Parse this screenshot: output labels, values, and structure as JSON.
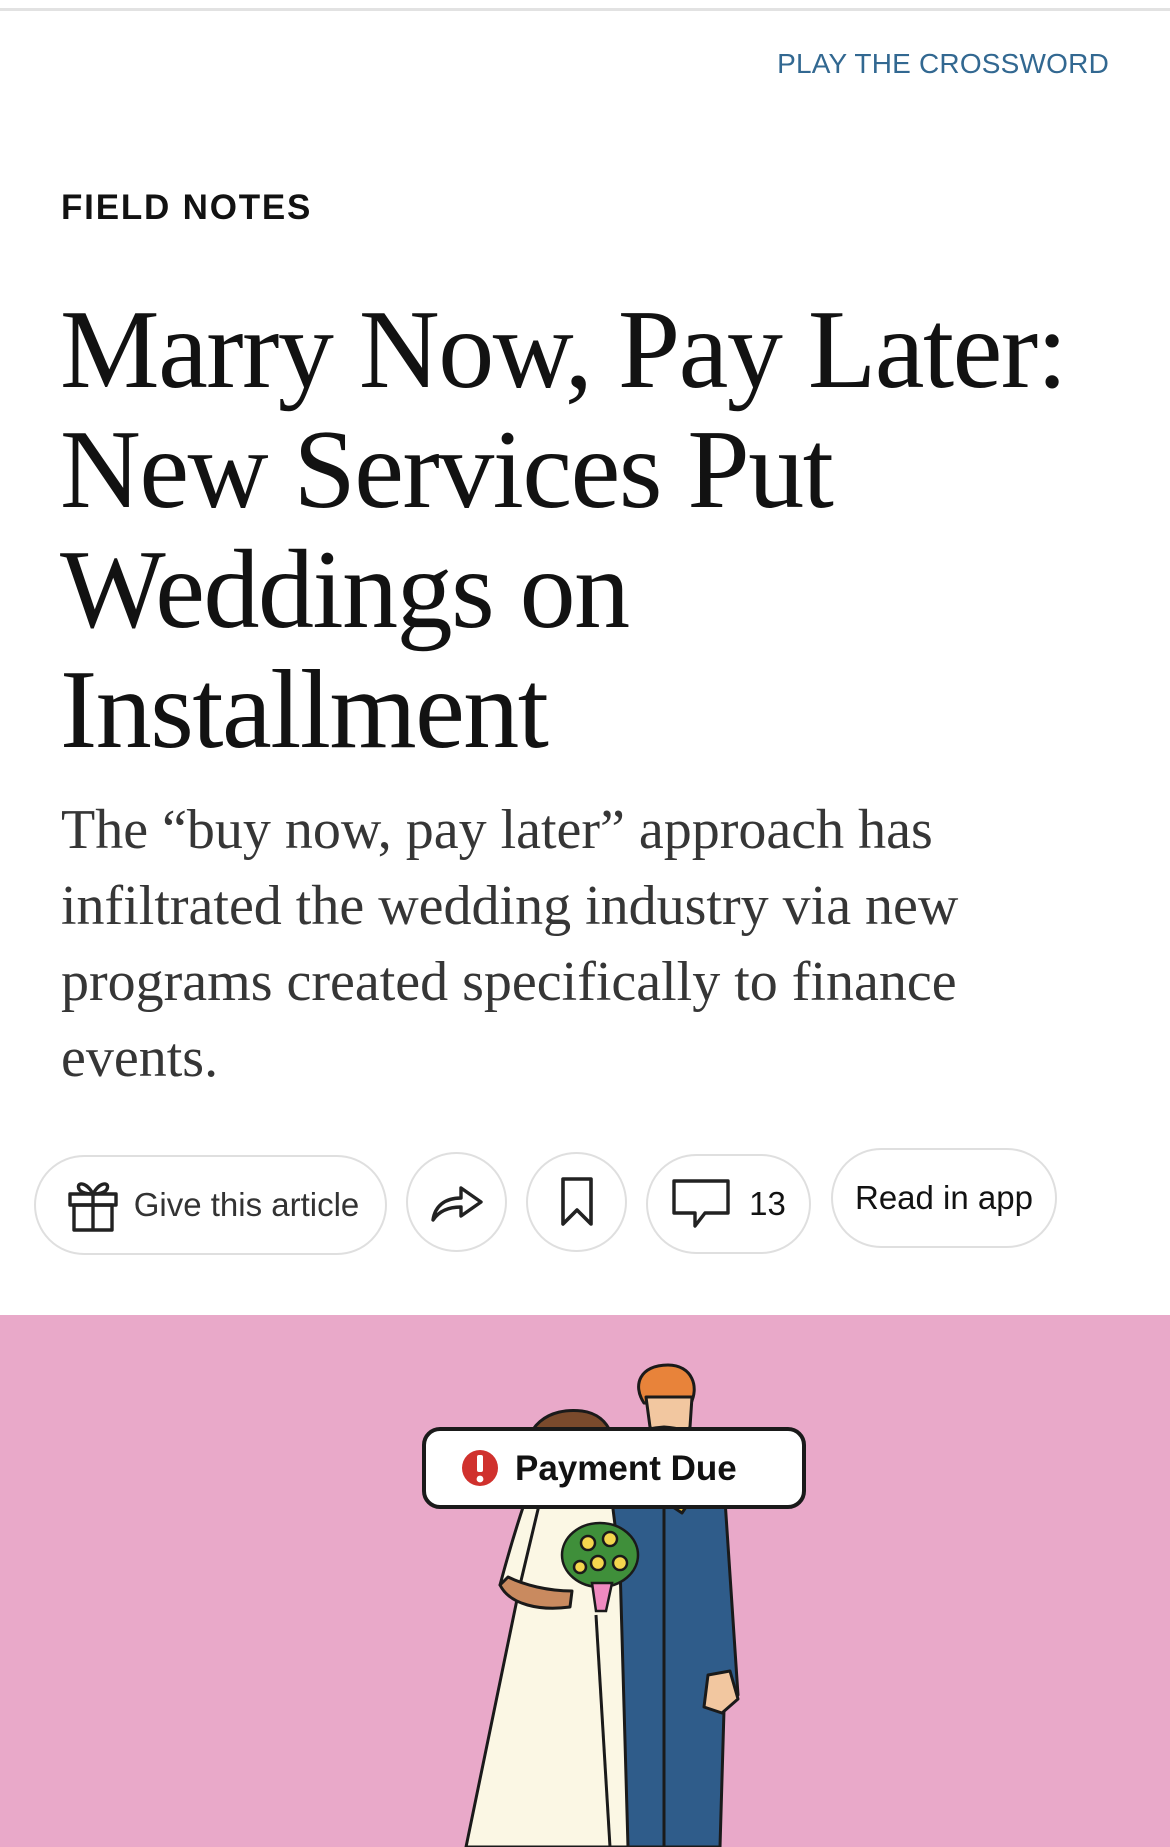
{
  "header": {
    "crossword_link": "PLAY THE CROSSWORD"
  },
  "article": {
    "kicker": "FIELD NOTES",
    "headline_lines": [
      "Marry Now, Pay Later:",
      "New Services Put",
      "Weddings on",
      "Installment"
    ],
    "summary": "The “buy now, pay later” approach has infiltrated the wedding industry via new programs created specifically to finance events."
  },
  "actions": {
    "gift_label": "Give this article",
    "comment_count": "13",
    "read_in_app_label": "Read in app",
    "icons": {
      "gift": "gift-icon",
      "share": "share-icon",
      "save": "bookmark-icon",
      "comments": "comment-icon"
    }
  },
  "hero": {
    "badge_text": "Payment Due",
    "badge_icon": "alert-icon",
    "colors": {
      "background": "#e9a9c9",
      "alert": "#d0312d",
      "suit": "#2f5c8a",
      "dress": "#fbf7e4"
    }
  }
}
